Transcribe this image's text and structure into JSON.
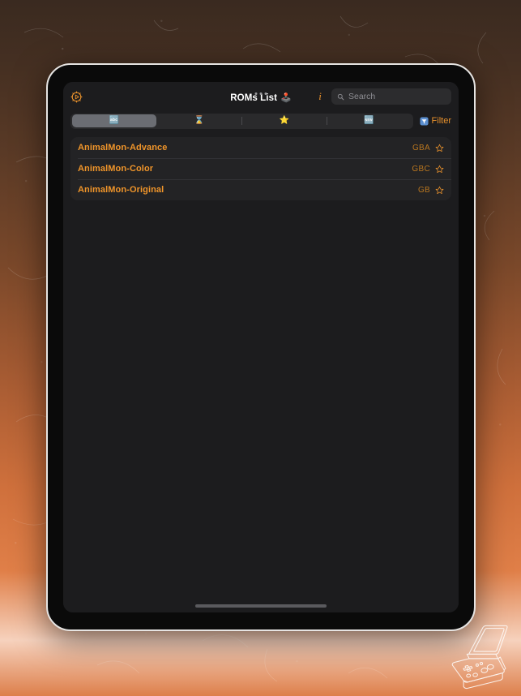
{
  "window": {
    "device": "tablet",
    "background_colors": {
      "top": "#3a2a20",
      "bottom": "#dd7f4b",
      "accent": "#e8912c"
    }
  },
  "navbar": {
    "app_icon": "gear-play-icon",
    "multitask_handle": "three-dots",
    "title": "ROMs List",
    "title_emoji": "🕹️",
    "info_label": "i",
    "search": {
      "placeholder": "Search",
      "value": "",
      "icon": "search-icon"
    }
  },
  "segmented_control": {
    "selected_index": 0,
    "segments": [
      {
        "name": "alphabetical",
        "icon": "🔤",
        "label": ""
      },
      {
        "name": "recent",
        "icon": "⌛",
        "label": ""
      },
      {
        "name": "favorites",
        "icon": "⭐",
        "label": ""
      },
      {
        "name": "new",
        "icon": "🆕",
        "label": ""
      }
    ]
  },
  "filter": {
    "label": "Filter",
    "icon": "funnel-icon",
    "color": "#e8912c"
  },
  "rom_list": {
    "rows": [
      {
        "name": "AnimalMon-Advance",
        "platform": "GBA",
        "favorite": false,
        "star_icon": "star-outline-icon"
      },
      {
        "name": "AnimalMon-Color",
        "platform": "GBC",
        "favorite": false,
        "star_icon": "star-outline-icon"
      },
      {
        "name": "AnimalMon-Original",
        "platform": "GB",
        "favorite": false,
        "star_icon": "star-outline-icon"
      }
    ]
  },
  "home_indicator": {
    "name": "home-indicator"
  },
  "decoration": {
    "artwork": "gameboy-advance-sp-line-art"
  }
}
